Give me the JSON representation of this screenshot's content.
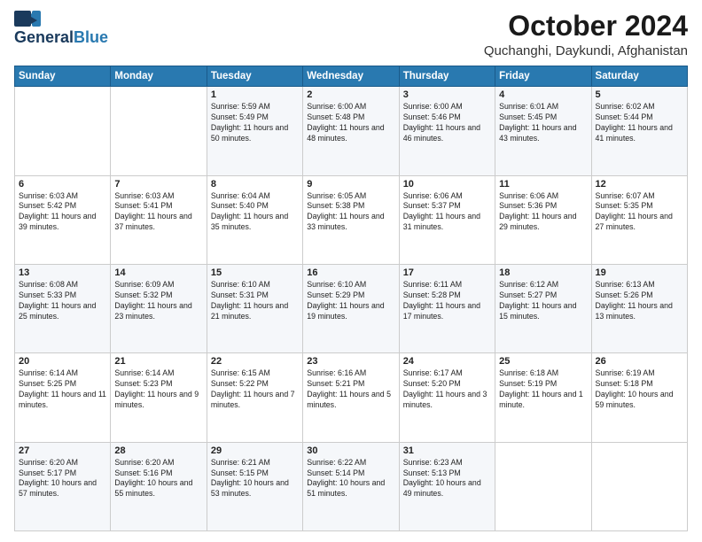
{
  "header": {
    "logo_line1": "General",
    "logo_line2": "Blue",
    "month_title": "October 2024",
    "location": "Quchanghi, Daykundi, Afghanistan"
  },
  "days_of_week": [
    "Sunday",
    "Monday",
    "Tuesday",
    "Wednesday",
    "Thursday",
    "Friday",
    "Saturday"
  ],
  "weeks": [
    [
      {
        "day": "",
        "info": ""
      },
      {
        "day": "",
        "info": ""
      },
      {
        "day": "1",
        "info": "Sunrise: 5:59 AM\nSunset: 5:49 PM\nDaylight: 11 hours and 50 minutes."
      },
      {
        "day": "2",
        "info": "Sunrise: 6:00 AM\nSunset: 5:48 PM\nDaylight: 11 hours and 48 minutes."
      },
      {
        "day": "3",
        "info": "Sunrise: 6:00 AM\nSunset: 5:46 PM\nDaylight: 11 hours and 46 minutes."
      },
      {
        "day": "4",
        "info": "Sunrise: 6:01 AM\nSunset: 5:45 PM\nDaylight: 11 hours and 43 minutes."
      },
      {
        "day": "5",
        "info": "Sunrise: 6:02 AM\nSunset: 5:44 PM\nDaylight: 11 hours and 41 minutes."
      }
    ],
    [
      {
        "day": "6",
        "info": "Sunrise: 6:03 AM\nSunset: 5:42 PM\nDaylight: 11 hours and 39 minutes."
      },
      {
        "day": "7",
        "info": "Sunrise: 6:03 AM\nSunset: 5:41 PM\nDaylight: 11 hours and 37 minutes."
      },
      {
        "day": "8",
        "info": "Sunrise: 6:04 AM\nSunset: 5:40 PM\nDaylight: 11 hours and 35 minutes."
      },
      {
        "day": "9",
        "info": "Sunrise: 6:05 AM\nSunset: 5:38 PM\nDaylight: 11 hours and 33 minutes."
      },
      {
        "day": "10",
        "info": "Sunrise: 6:06 AM\nSunset: 5:37 PM\nDaylight: 11 hours and 31 minutes."
      },
      {
        "day": "11",
        "info": "Sunrise: 6:06 AM\nSunset: 5:36 PM\nDaylight: 11 hours and 29 minutes."
      },
      {
        "day": "12",
        "info": "Sunrise: 6:07 AM\nSunset: 5:35 PM\nDaylight: 11 hours and 27 minutes."
      }
    ],
    [
      {
        "day": "13",
        "info": "Sunrise: 6:08 AM\nSunset: 5:33 PM\nDaylight: 11 hours and 25 minutes."
      },
      {
        "day": "14",
        "info": "Sunrise: 6:09 AM\nSunset: 5:32 PM\nDaylight: 11 hours and 23 minutes."
      },
      {
        "day": "15",
        "info": "Sunrise: 6:10 AM\nSunset: 5:31 PM\nDaylight: 11 hours and 21 minutes."
      },
      {
        "day": "16",
        "info": "Sunrise: 6:10 AM\nSunset: 5:29 PM\nDaylight: 11 hours and 19 minutes."
      },
      {
        "day": "17",
        "info": "Sunrise: 6:11 AM\nSunset: 5:28 PM\nDaylight: 11 hours and 17 minutes."
      },
      {
        "day": "18",
        "info": "Sunrise: 6:12 AM\nSunset: 5:27 PM\nDaylight: 11 hours and 15 minutes."
      },
      {
        "day": "19",
        "info": "Sunrise: 6:13 AM\nSunset: 5:26 PM\nDaylight: 11 hours and 13 minutes."
      }
    ],
    [
      {
        "day": "20",
        "info": "Sunrise: 6:14 AM\nSunset: 5:25 PM\nDaylight: 11 hours and 11 minutes."
      },
      {
        "day": "21",
        "info": "Sunrise: 6:14 AM\nSunset: 5:23 PM\nDaylight: 11 hours and 9 minutes."
      },
      {
        "day": "22",
        "info": "Sunrise: 6:15 AM\nSunset: 5:22 PM\nDaylight: 11 hours and 7 minutes."
      },
      {
        "day": "23",
        "info": "Sunrise: 6:16 AM\nSunset: 5:21 PM\nDaylight: 11 hours and 5 minutes."
      },
      {
        "day": "24",
        "info": "Sunrise: 6:17 AM\nSunset: 5:20 PM\nDaylight: 11 hours and 3 minutes."
      },
      {
        "day": "25",
        "info": "Sunrise: 6:18 AM\nSunset: 5:19 PM\nDaylight: 11 hours and 1 minute."
      },
      {
        "day": "26",
        "info": "Sunrise: 6:19 AM\nSunset: 5:18 PM\nDaylight: 10 hours and 59 minutes."
      }
    ],
    [
      {
        "day": "27",
        "info": "Sunrise: 6:20 AM\nSunset: 5:17 PM\nDaylight: 10 hours and 57 minutes."
      },
      {
        "day": "28",
        "info": "Sunrise: 6:20 AM\nSunset: 5:16 PM\nDaylight: 10 hours and 55 minutes."
      },
      {
        "day": "29",
        "info": "Sunrise: 6:21 AM\nSunset: 5:15 PM\nDaylight: 10 hours and 53 minutes."
      },
      {
        "day": "30",
        "info": "Sunrise: 6:22 AM\nSunset: 5:14 PM\nDaylight: 10 hours and 51 minutes."
      },
      {
        "day": "31",
        "info": "Sunrise: 6:23 AM\nSunset: 5:13 PM\nDaylight: 10 hours and 49 minutes."
      },
      {
        "day": "",
        "info": ""
      },
      {
        "day": "",
        "info": ""
      }
    ]
  ]
}
